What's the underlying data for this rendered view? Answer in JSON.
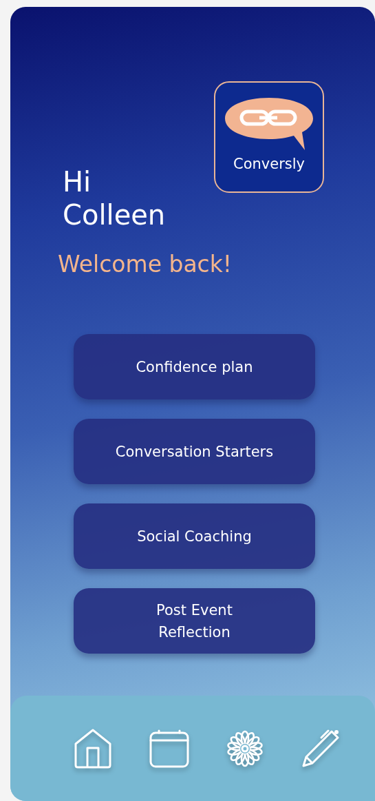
{
  "greeting": {
    "lines": [
      "Hi",
      "Colleen"
    ],
    "subtitle": "Welcome back!"
  },
  "logo": {
    "name": "Conversly"
  },
  "menu": [
    {
      "label": "Confidence plan"
    },
    {
      "label": "Conversation Starters"
    },
    {
      "label": "Social Coaching"
    },
    {
      "label": "Post Event\nReflection"
    }
  ],
  "nav": [
    {
      "kind": "home"
    },
    {
      "kind": "calendar"
    },
    {
      "kind": "flower"
    },
    {
      "kind": "pen"
    }
  ]
}
